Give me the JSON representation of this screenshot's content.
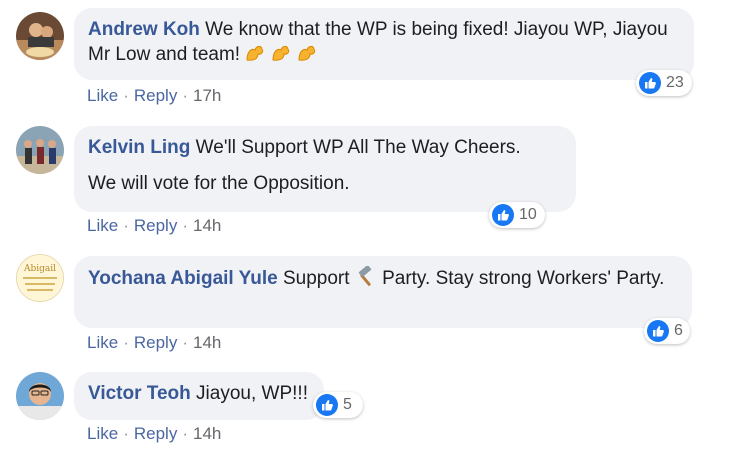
{
  "colors": {
    "author": "#385898",
    "action": "#4b67a1",
    "bubble": "#f0f2f5",
    "like_blue": "#1877f2",
    "muted": "#65676b"
  },
  "comments": [
    {
      "author": "Andrew Koh",
      "text": " We know that the WP is being fixed! Jiayou WP, Jiayou Mr Low and team! ",
      "emoji": "flexed-biceps x3",
      "reactions": "23",
      "like": "Like",
      "reply": "Reply",
      "time": "17h"
    },
    {
      "author": "Kelvin Ling",
      "text": " We'll Support WP All The Way Cheers.",
      "text2": "We will vote for the Opposition.",
      "reactions": "10",
      "like": "Like",
      "reply": "Reply",
      "time": "14h"
    },
    {
      "author": "Yochana Abigail Yule",
      "text_before": " Support ",
      "icon": "hammer-icon",
      "text_after": " Party. Stay strong Workers' Party.",
      "reactions": "6",
      "like": "Like",
      "reply": "Reply",
      "time": "14h"
    },
    {
      "author": "Victor Teoh",
      "text": " Jiayou, WP!!!",
      "reactions": "5",
      "like": "Like",
      "reply": "Reply",
      "time": "14h"
    }
  ]
}
